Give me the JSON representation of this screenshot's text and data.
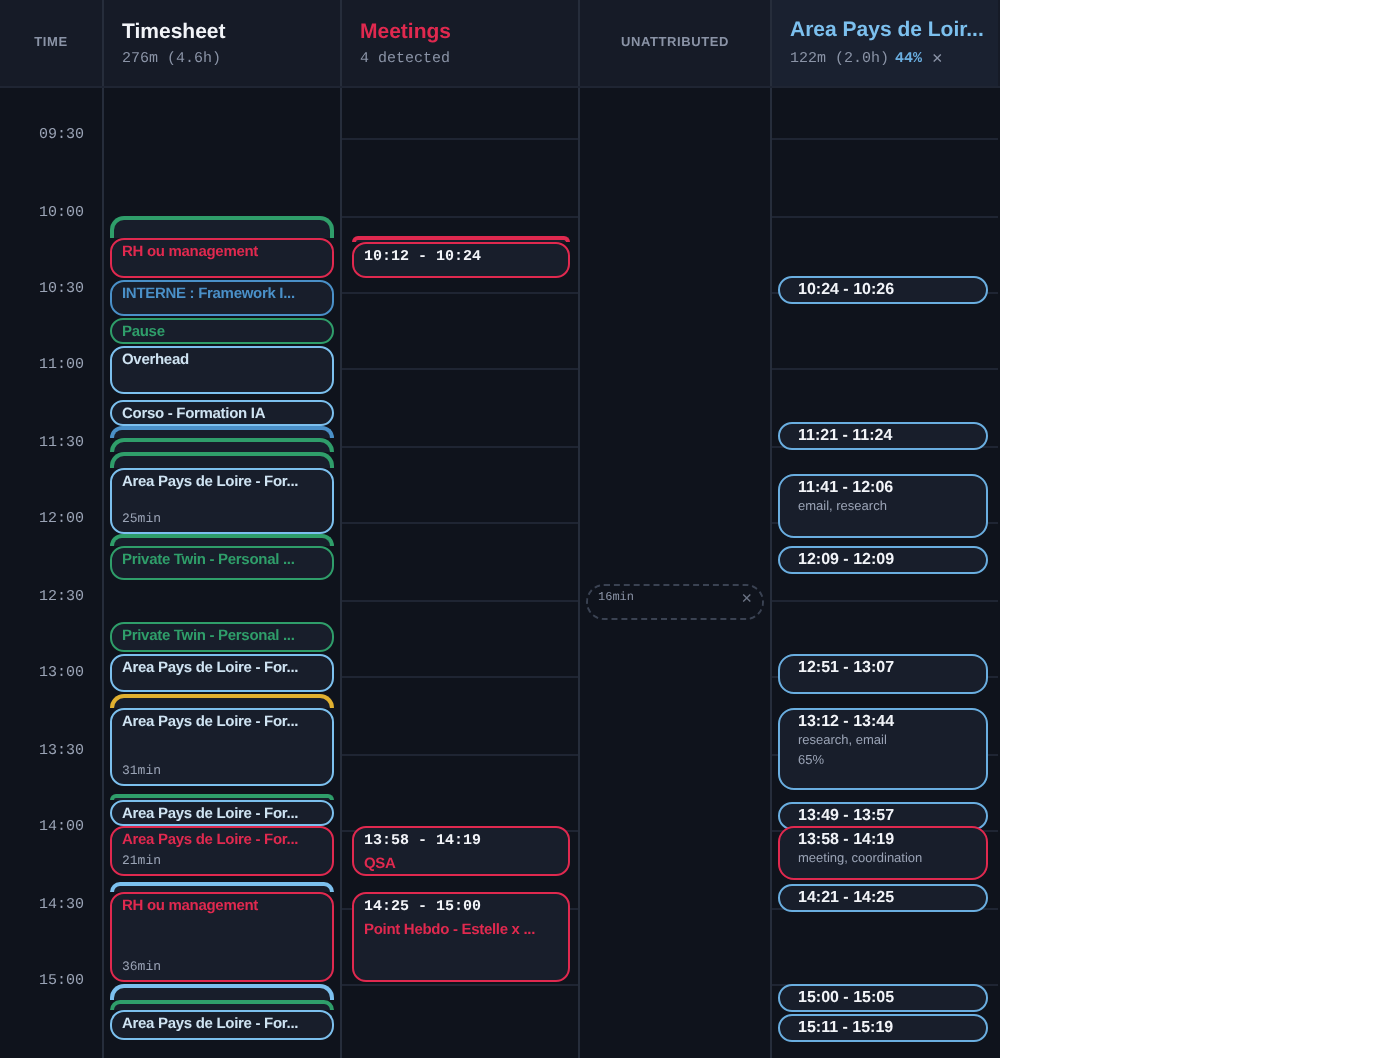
{
  "time_header": "TIME",
  "time_labels": [
    "09:30",
    "10:00",
    "10:30",
    "11:00",
    "11:30",
    "12:00",
    "12:30",
    "13:00",
    "13:30",
    "14:00",
    "14:30",
    "15:00"
  ],
  "timesheet": {
    "title": "Timesheet",
    "summary": "276m (4.6h)",
    "entries": [
      {
        "color": "#2f9e6a"
      },
      {
        "color": "#e0294f",
        "label": "RH ou management"
      },
      {
        "color": "#4a90c8",
        "label": "INTERNE : Framework I..."
      },
      {
        "color": "#2f9e6a",
        "label": "Pause"
      },
      {
        "color": "#7cc0ee",
        "label": "Overhead"
      },
      {
        "color": "#7cc0ee",
        "label": "Corso - Formation IA"
      },
      {
        "color": "#4a90c8"
      },
      {
        "color": "#2f9e6a"
      },
      {
        "color": "#2f9e6a"
      },
      {
        "color": "#7cc0ee",
        "label": "Area Pays de Loire - For...",
        "duration": "25min"
      },
      {
        "color": "#2f9e6a"
      },
      {
        "color": "#2f9e6a",
        "label": "Private Twin - Personal ..."
      },
      {
        "color": "#2f9e6a",
        "label": "Private Twin - Personal ..."
      },
      {
        "color": "#7cc0ee",
        "label": "Area Pays de Loire - For..."
      },
      {
        "color": "#e0b030"
      },
      {
        "color": "#7cc0ee",
        "label": "Area Pays de Loire - For...",
        "duration": "31min"
      },
      {
        "color": "#2f9e6a"
      },
      {
        "color": "#7cc0ee",
        "label": "Area Pays de Loire - For..."
      },
      {
        "color": "#e0294f",
        "label": "Area Pays de Loire - For...",
        "duration": "21min"
      },
      {
        "color": "#7cc0ee"
      },
      {
        "color": "#e0294f",
        "label": "RH ou management",
        "duration": "36min"
      },
      {
        "color": "#7cc0ee"
      },
      {
        "color": "#2f9e6a"
      },
      {
        "color": "#7cc0ee",
        "label": "Area Pays de Loire - For..."
      }
    ]
  },
  "meetings": {
    "title": "Meetings",
    "summary": "4 detected",
    "entries": [
      {
        "kind": "peek"
      },
      {
        "kind": "card",
        "time": "10:12 - 10:24"
      },
      {
        "kind": "card",
        "time": "13:58 - 14:19",
        "label": "QSA"
      },
      {
        "kind": "card",
        "time": "14:25 - 15:00",
        "label": "Point Hebdo - Estelle x ..."
      }
    ]
  },
  "unattributed": {
    "title": "UNATTRIBUTED",
    "blocks": [
      {
        "duration": "16min",
        "close": "×"
      }
    ]
  },
  "area": {
    "title": "Area Pays de Loir...",
    "summary": "122m (2.0h)",
    "percent": "44%",
    "close": "×",
    "entries": [
      {
        "time": "10:24 - 10:26",
        "color": "#6aaee0"
      },
      {
        "time": "11:21 - 11:24",
        "color": "#6aaee0"
      },
      {
        "time": "11:41 - 12:06",
        "tags": "email, research",
        "color": "#6aaee0"
      },
      {
        "time": "12:09 - 12:09",
        "color": "#6aaee0"
      },
      {
        "time": "12:51 - 13:07",
        "color": "#6aaee0"
      },
      {
        "time": "13:12 - 13:44",
        "tags": "research, email",
        "percent": "65%",
        "color": "#6aaee0"
      },
      {
        "time": "13:49 - 13:57",
        "color": "#6aaee0"
      },
      {
        "time": "13:58 - 14:19",
        "tags": "meeting, coordination",
        "color": "#e0294f"
      },
      {
        "time": "14:21 - 14:25",
        "color": "#6aaee0"
      },
      {
        "time": "15:00 - 15:05",
        "color": "#6aaee0"
      },
      {
        "time": "15:11 - 15:19",
        "color": "#6aaee0"
      }
    ]
  }
}
